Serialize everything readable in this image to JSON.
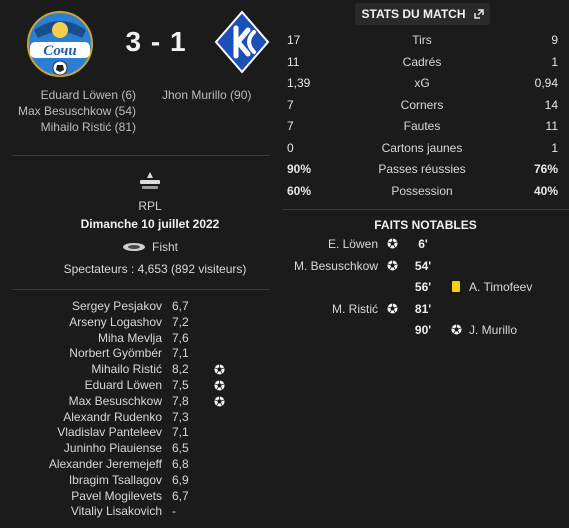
{
  "match": {
    "score": "3 - 1",
    "home_scorers": [
      "Eduard Löwen (6)",
      "Max Besuschkow (54)",
      "Mihailo Ristić (81)"
    ],
    "away_scorers": [
      "Jhon Murillo (90)"
    ],
    "home_logo_text": "Сочи",
    "competition": "RPL",
    "date": "Dimanche 10 juillet 2022",
    "stadium": "Fisht",
    "spectators": "Spectateurs : 4,653 (892 visiteurs)"
  },
  "ratings": [
    {
      "name": "Sergey Pesjakov",
      "rating": "6,7",
      "goal": false
    },
    {
      "name": "Arseny Logashov",
      "rating": "7,2",
      "goal": false
    },
    {
      "name": "Miha Mevlja",
      "rating": "7,6",
      "goal": false
    },
    {
      "name": "Norbert Gyömbér",
      "rating": "7,1",
      "goal": false
    },
    {
      "name": "Mihailo Ristić",
      "rating": "8,2",
      "goal": true
    },
    {
      "name": "Eduard Löwen",
      "rating": "7,5",
      "goal": true
    },
    {
      "name": "Max Besuschkow",
      "rating": "7,8",
      "goal": true
    },
    {
      "name": "Alexandr Rudenko",
      "rating": "7,3",
      "goal": false
    },
    {
      "name": "Vladislav Panteleev",
      "rating": "7,1",
      "goal": false
    },
    {
      "name": "Juninho Piauiense",
      "rating": "6,5",
      "goal": false
    },
    {
      "name": "Alexander Jeremejeff",
      "rating": "6,8",
      "goal": false
    },
    {
      "name": "Ibragim Tsallagov",
      "rating": "6,9",
      "goal": false
    },
    {
      "name": "Pavel Mogilevets",
      "rating": "6,7",
      "goal": false
    },
    {
      "name": "Vitaliy Lisakovich",
      "rating": "-",
      "goal": false
    }
  ],
  "stats": {
    "title": "STATS DU MATCH",
    "rows": [
      {
        "home": "17",
        "label": "Tirs",
        "away": "9",
        "bold": false
      },
      {
        "home": "11",
        "label": "Cadrés",
        "away": "1",
        "bold": false
      },
      {
        "home": "1,39",
        "label": "xG",
        "away": "0,94",
        "bold": false
      },
      {
        "home": "7",
        "label": "Corners",
        "away": "14",
        "bold": false
      },
      {
        "home": "7",
        "label": "Fautes",
        "away": "11",
        "bold": false
      },
      {
        "home": "0",
        "label": "Cartons jaunes",
        "away": "1",
        "bold": false
      },
      {
        "home": "90%",
        "label": "Passes réussies",
        "away": "76%",
        "bold": true
      },
      {
        "home": "60%",
        "label": "Possession",
        "away": "40%",
        "bold": true
      }
    ]
  },
  "events": {
    "title": "FAITS NOTABLES",
    "rows": [
      {
        "home": "E. Löwen",
        "minute": "6'",
        "away": "",
        "type": "goal-home"
      },
      {
        "home": "M. Besuschkow",
        "minute": "54'",
        "away": "",
        "type": "goal-home"
      },
      {
        "home": "",
        "minute": "56'",
        "away": "A. Timofeev",
        "type": "yellow-away"
      },
      {
        "home": "M. Ristić",
        "minute": "81'",
        "away": "",
        "type": "goal-home"
      },
      {
        "home": "",
        "minute": "90'",
        "away": "J. Murillo",
        "type": "goal-away"
      }
    ]
  },
  "colors": {
    "background": "#1b1b1b",
    "sochi_blue": "#1f73c8",
    "krylia_blue": "#1d4fb8",
    "yellow_card": "#f2d40a"
  },
  "icons": {
    "goal": "football-icon",
    "card": "yellow-card-icon",
    "expand": "expand-icon",
    "stadium": "stadium-icon"
  }
}
